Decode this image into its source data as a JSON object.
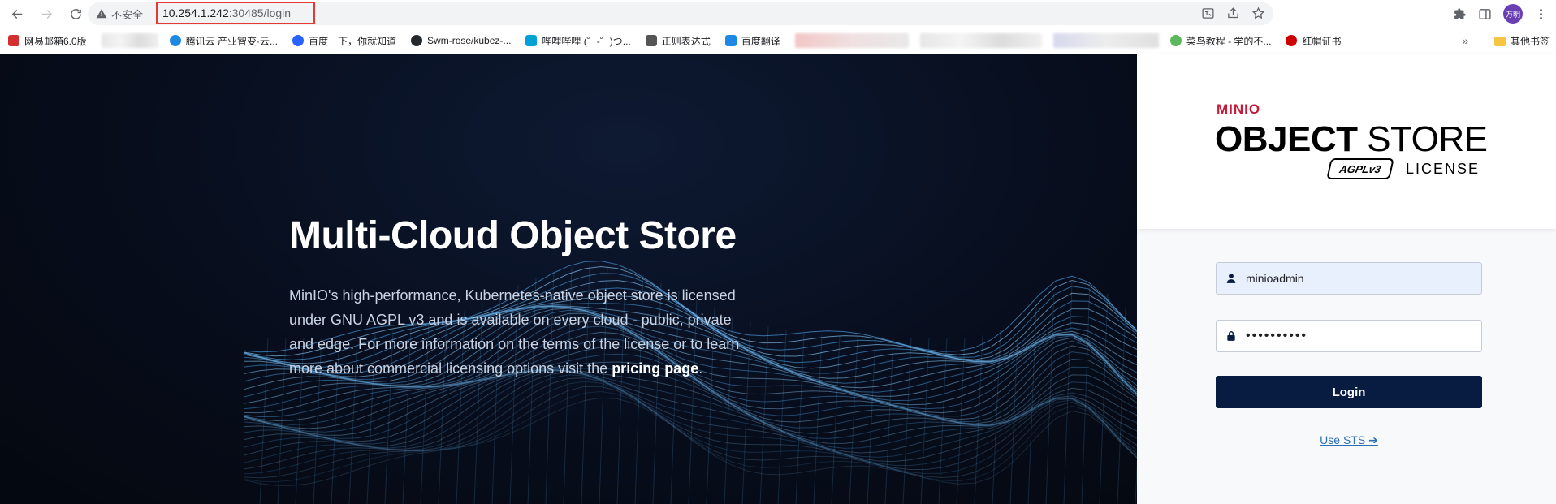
{
  "browser": {
    "insecure_label": "不安全",
    "url_host": "10.254.1.242",
    "url_rest": ":30485/login",
    "profile_label": "万明"
  },
  "bookmarks": [
    {
      "label": "网易邮箱6.0版",
      "color": "#d32f2f"
    },
    {
      "label": "腾讯云 产业智变·云...",
      "color": "#1e88e5"
    },
    {
      "label": "百度一下，你就知道",
      "color": "#2962ff"
    },
    {
      "label": "Swm-rose/kubez-...",
      "color": "#24292e"
    },
    {
      "label": "哔哩哔哩 (゜-゜)つ...",
      "color": "#00a1d6"
    },
    {
      "label": "正则表达式",
      "color": "#555555"
    },
    {
      "label": "百度翻译",
      "color": "#1e88e5"
    },
    {
      "label": "菜鸟教程 - 学的不...",
      "color": "#5cb85c"
    },
    {
      "label": "红帽证书",
      "color": "#cc0000"
    }
  ],
  "bookmarks_more": "»",
  "bookmarks_other": "其他书签",
  "hero": {
    "title": "Multi-Cloud Object Store",
    "text_before": "MinIO's high-performance, Kubernetes-native object store is licensed under GNU AGPL v3 and is available on every cloud - public, private and edge. For more information on the terms of the license or to learn more about commercial licensing options visit the ",
    "link": "pricing page",
    "text_after": "."
  },
  "logo": {
    "brand": "MINIO",
    "object": "OBJECT",
    "store": " STORE",
    "agpl": "AGPLv3",
    "license": "LICENSE"
  },
  "form": {
    "username": "minioadmin",
    "password_masked": "••••••••••",
    "login_label": "Login",
    "sts_label": "Use STS ➔"
  },
  "colors": {
    "panel_dark": "#081c42",
    "brand_red": "#c51b3a"
  }
}
